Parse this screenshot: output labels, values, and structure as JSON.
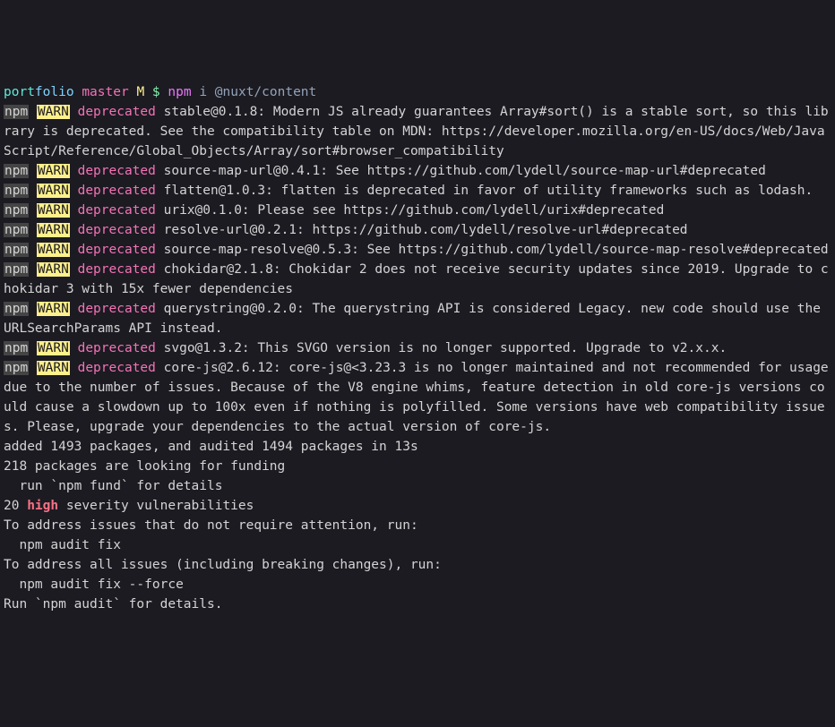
{
  "prompt": {
    "port": "port",
    "folio": "folio",
    "branch": "master",
    "m": "M",
    "dollar": "$",
    "npm": "npm",
    "args": "i @nuxt/content"
  },
  "labels": {
    "npm": "npm",
    "warn": "WARN",
    "deprecated": "deprecated",
    "high": "high"
  },
  "warnings": [
    " stable@0.1.8: Modern JS already guarantees Array#sort() is a stable sort, so this library is deprecated. See the compatibility table on MDN: https://developer.mozilla.org/en-US/docs/Web/JavaScript/Reference/Global_Objects/Array/sort#browser_compatibility",
    " source-map-url@0.4.1: See https://github.com/lydell/source-map-url#deprecated",
    " flatten@1.0.3: flatten is deprecated in favor of utility frameworks such as lodash.",
    " urix@0.1.0: Please see https://github.com/lydell/urix#deprecated",
    " resolve-url@0.2.1: https://github.com/lydell/resolve-url#deprecated",
    " source-map-resolve@0.5.3: See https://github.com/lydell/source-map-resolve#deprecated",
    " chokidar@2.1.8: Chokidar 2 does not receive security updates since 2019. Upgrade to chokidar 3 with 15x fewer dependencies",
    " querystring@0.2.0: The querystring API is considered Legacy. new code should use the URLSearchParams API instead.",
    " svgo@1.3.2: This SVGO version is no longer supported. Upgrade to v2.x.x.",
    " core-js@2.6.12: core-js@<3.23.3 is no longer maintained and not recommended for usage due to the number of issues. Because of the V8 engine whims, feature detection in old core-js versions could cause a slowdown up to 100x even if nothing is polyfilled. Some versions have web compatibility issues. Please, upgrade your dependencies to the actual version of core-js."
  ],
  "summary": {
    "blank1": "",
    "added": "added 1493 packages, and audited 1494 packages in 13s",
    "blank2": "",
    "funding1": "218 packages are looking for funding",
    "funding2": "  run `npm fund` for details",
    "blank3": "",
    "vuln_count": "20 ",
    "vuln_rest": " severity vulnerabilities",
    "blank4": "",
    "addr1": "To address issues that do not require attention, run:",
    "addr2": "  npm audit fix",
    "blank5": "",
    "addr3": "To address all issues (including breaking changes), run:",
    "addr4": "  npm audit fix --force",
    "blank6": "",
    "audit": "Run `npm audit` for details."
  }
}
